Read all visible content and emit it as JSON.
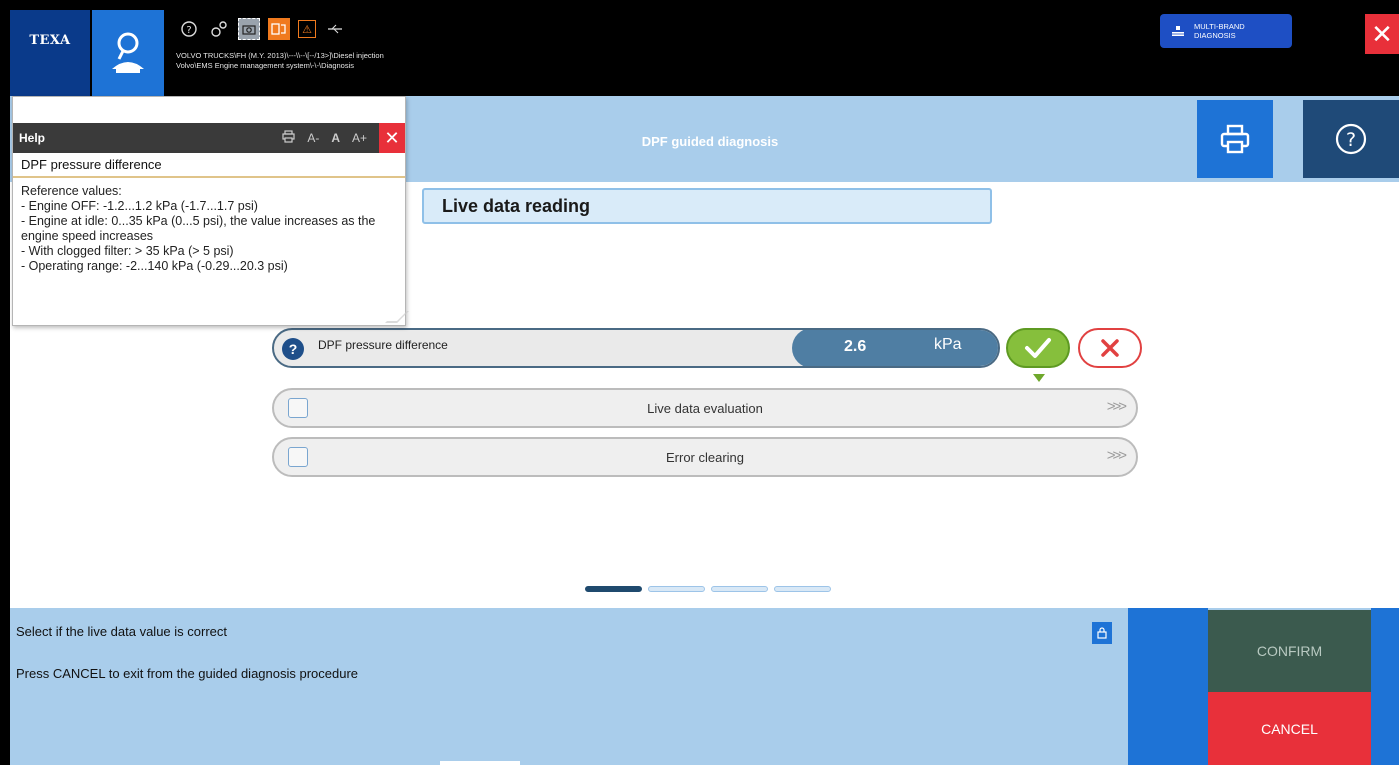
{
  "app": {
    "logo": "TEXA",
    "path_line1": "VOLVO TRUCKS\\FH (M.Y. 2013)\\---\\\\--\\[--/13>]\\Diesel injection",
    "path_line2": "Volvo\\EMS Engine management system\\-\\-\\Diagnosis",
    "multibrand_line1": "MULTI-BRAND",
    "multibrand_line2": "DIAGNOSIS"
  },
  "toolbar": {
    "icons": [
      "help-icon",
      "settings-icon",
      "camera-icon",
      "connection-icon",
      "warning-icon",
      "usb-icon"
    ]
  },
  "header": {
    "title": "DPF guided diagnosis"
  },
  "section": {
    "title": "Live data reading"
  },
  "parameter": {
    "label": "DPF pressure difference",
    "value": "2.6",
    "unit": "kPa"
  },
  "steps": [
    {
      "label": "Live data evaluation"
    },
    {
      "label": "Error clearing"
    }
  ],
  "pager": {
    "total": 4,
    "active": 1
  },
  "help": {
    "title": "Help",
    "subtitle": "DPF pressure difference",
    "body": "Reference values:\n- Engine OFF: -1.2...1.2 kPa (-1.7...1.7 psi)\n- Engine at idle: 0...35 kPa (0...5 psi), the value increases as the engine speed increases\n- With clogged filter: > 35 kPa (> 5 psi)\n- Operating range: -2...140 kPa (-0.29...20.3 psi)",
    "font_small": "A-",
    "font_normal": "A",
    "font_large": "A+"
  },
  "bottom": {
    "message1": "Select if the live data value is correct",
    "message2": "Press CANCEL to exit from the guided diagnosis procedure",
    "confirm_label": "CONFIRM",
    "cancel_label": "CANCEL"
  },
  "colors": {
    "accent_blue": "#1e73d6",
    "light_blue": "#a9cdeb",
    "cancel_red": "#e8303a",
    "confirm_green": "#3b5a4e",
    "ok_green": "#86bf3c"
  }
}
